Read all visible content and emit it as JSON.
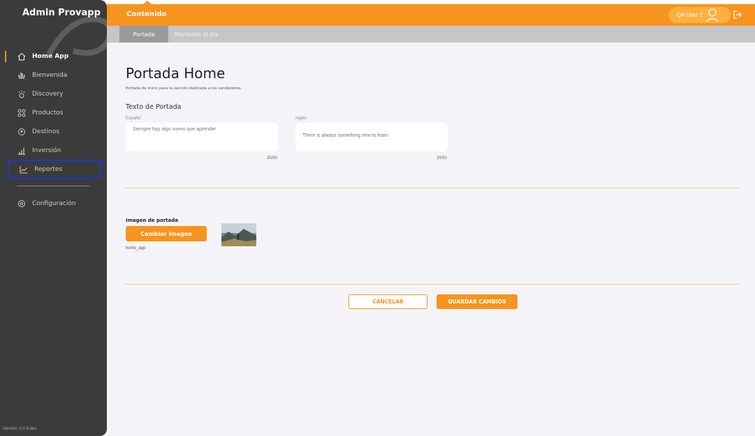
{
  "app": {
    "brand": "Admin Provapp",
    "version": "Versión: 0.0.9-dev"
  },
  "sidebar": {
    "items": [
      {
        "label": "Home App",
        "icon": "home-icon"
      },
      {
        "label": "Bienvenida",
        "icon": "hand-wave-icon"
      },
      {
        "label": "Discovery",
        "icon": "discovery-icon"
      },
      {
        "label": "Productos",
        "icon": "products-grid-icon"
      },
      {
        "label": "Destinos",
        "icon": "location-pin-icon"
      },
      {
        "label": "Inversión",
        "icon": "chart-bars-icon"
      },
      {
        "label": "Reportes",
        "icon": "trend-chart-icon"
      },
      {
        "label": "Configuración",
        "icon": "settings-icon"
      }
    ]
  },
  "topbar": {
    "title": "Contenido",
    "user": "QA User 2"
  },
  "tabs": [
    {
      "label": "Portada"
    },
    {
      "label": "Mantente al día"
    }
  ],
  "main": {
    "title": "Portada Home",
    "subtitle": "Portada de inicio para la sección dedicada a los vendedores.",
    "section_title": "Texto de Portada",
    "fields": {
      "es": {
        "label": "Español",
        "value": "Siempre hay algo nuevo que aprender",
        "counter": "35/50"
      },
      "en": {
        "label": "Inglés",
        "value": "There is always something new to learn",
        "counter": "39/50"
      }
    },
    "image": {
      "title": "Imagen de portada",
      "button": "Cambiar imagen",
      "filename": "home_app"
    },
    "actions": {
      "cancel": "CANCELAR",
      "save": "GUARDAR CAMBIOS"
    }
  },
  "colors": {
    "accent": "#f7941d",
    "sidebar": "#3b3b3b",
    "highlight": "#1e37c8"
  }
}
